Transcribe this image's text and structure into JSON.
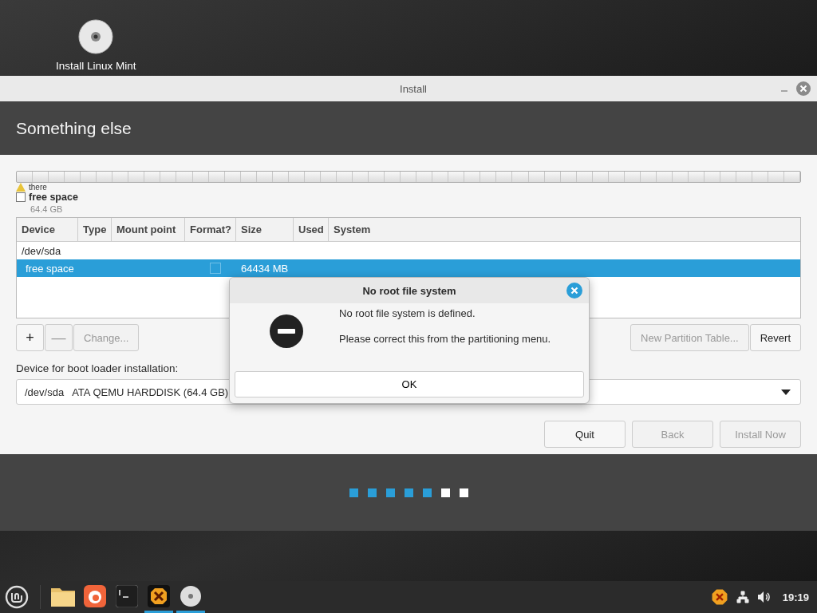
{
  "desktop_icon": {
    "label": "Install Linux Mint"
  },
  "window": {
    "title": "Install",
    "heading": "Something else"
  },
  "partition_bar": {
    "warning": "there",
    "legend": "free space",
    "size": "64.4 GB",
    "checked": false
  },
  "table": {
    "columns": [
      "Device",
      "Type",
      "Mount point",
      "Format?",
      "Size",
      "Used",
      "System"
    ],
    "rows": [
      {
        "device": "/dev/sda",
        "selected": false,
        "children": [
          {
            "device": "free space",
            "selected": true,
            "format": false,
            "size": "64434 MB"
          }
        ]
      }
    ]
  },
  "tools": [
    {
      "label": "+",
      "disabled": false
    },
    {
      "label": "—",
      "disabled": true
    },
    {
      "label": "Change...",
      "disabled": true
    }
  ],
  "right_tools": [
    {
      "label": "New Partition Table...",
      "disabled": true
    },
    {
      "label": "Revert",
      "disabled": false
    }
  ],
  "boot_loader": {
    "label": "Device for boot loader installation:",
    "device": "/dev/sda",
    "description": "ATA QEMU HARDDISK (64.4 GB)"
  },
  "buttons": [
    {
      "label": "Quit",
      "disabled": false
    },
    {
      "label": "Back",
      "disabled": true
    },
    {
      "label": "Install Now",
      "disabled": true
    }
  ],
  "steps": [
    {
      "done": true
    },
    {
      "done": true
    },
    {
      "done": true
    },
    {
      "done": true
    },
    {
      "done": true
    },
    {
      "done": false
    },
    {
      "done": false
    }
  ],
  "dialog": {
    "title": "No root file system",
    "message": "No root file system is defined.",
    "detail": "Please correct this from the partitioning menu.",
    "button": "OK"
  },
  "taskbar": {
    "launchers": [
      {
        "kind": "folder",
        "running": false
      },
      {
        "kind": "browser",
        "running": false
      },
      {
        "kind": "terminal",
        "running": false
      },
      {
        "kind": "xapp",
        "running": true
      },
      {
        "kind": "disc",
        "running": true
      }
    ],
    "clock": "19:19"
  }
}
